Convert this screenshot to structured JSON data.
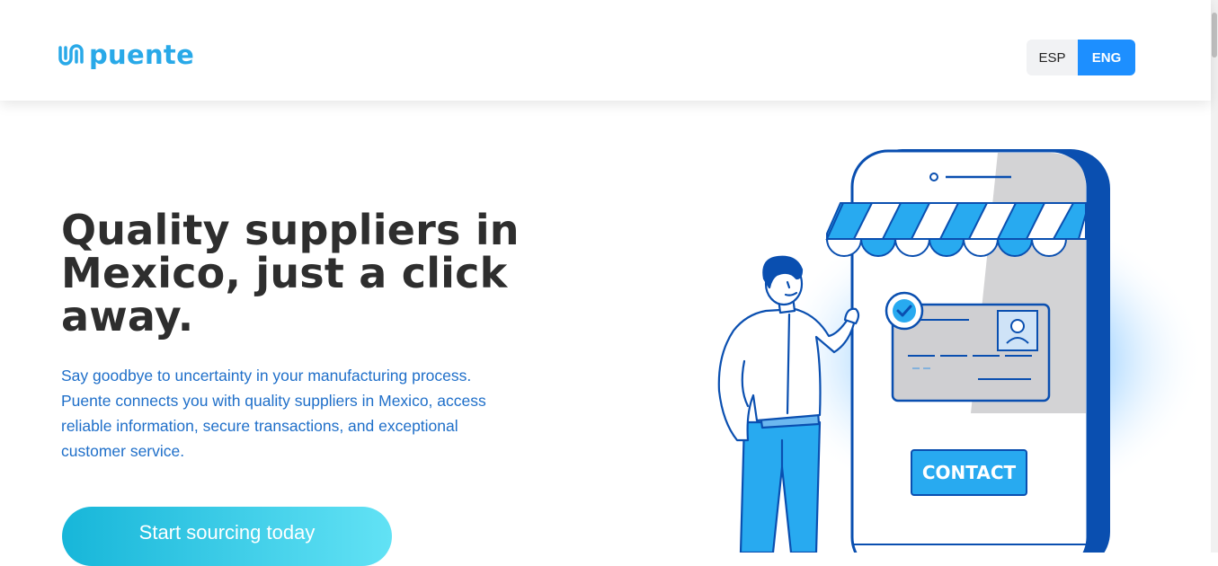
{
  "header": {
    "logo_text": "puente",
    "lang": {
      "esp": "ESP",
      "eng": "ENG",
      "selected": "ENG"
    }
  },
  "hero": {
    "title": "Quality suppliers in Mexico, just a click away.",
    "description": "Say goodbye to uncertainty in your manufacturing process. Puente connects you with quality suppliers in Mexico, access reliable information, secure transactions, and exceptional customer service.",
    "cta_label": "Start sourcing today"
  },
  "illustration": {
    "contact_label": "CONTACT"
  },
  "colors": {
    "brand": "#29a9e8",
    "accent": "#1d8fff",
    "text_blue": "#1f6fc9",
    "cta_start": "#17b6d9",
    "cta_end": "#62e2f5"
  }
}
